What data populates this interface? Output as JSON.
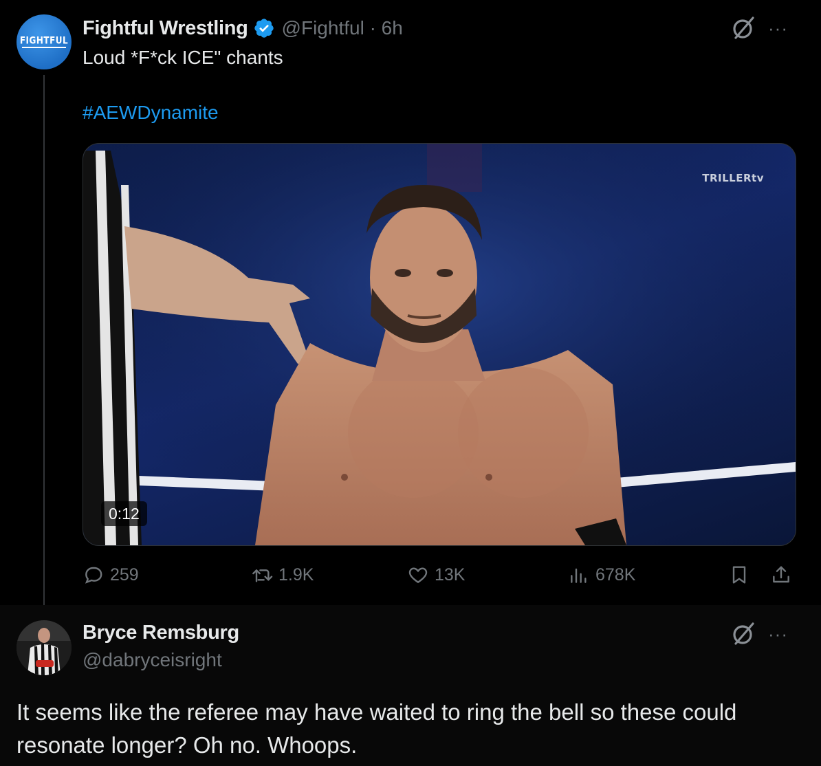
{
  "tweet": {
    "avatar_text": "FIGHTFUL",
    "display_name": "Fightful Wrestling",
    "verified_icon": "verified-badge-icon",
    "handle_meta": "@Fightful · 6h",
    "text": "Loud *F*ck ICE\" chants",
    "hashtag": "#AEWDynamite",
    "media": {
      "watermark": "TRILLERtv",
      "duration": "0:12"
    },
    "actions": {
      "reply_count": "259",
      "repost_count": "1.9K",
      "like_count": "13K",
      "views_count": "678K"
    },
    "more": "···"
  },
  "reply": {
    "display_name": "Bryce Remsburg",
    "handle": "@dabryceisright",
    "more": "···",
    "text": "It seems like the referee may have waited to ring the bell so these could resonate longer? Oh no. Whoops."
  },
  "colors": {
    "background": "#000000",
    "text_primary": "#e7e9ea",
    "text_secondary": "#71767b",
    "accent": "#1d9bf0"
  }
}
